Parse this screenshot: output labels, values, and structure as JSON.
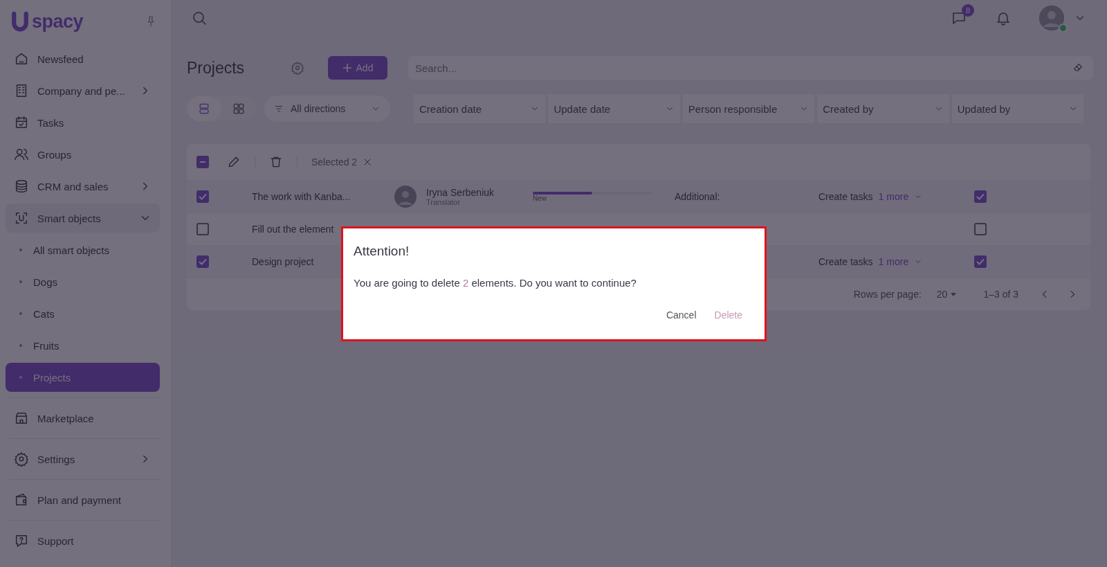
{
  "logo": {
    "text": "spacy"
  },
  "sidebar": {
    "sections": [
      [
        {
          "label": "Newsfeed",
          "expandable": false,
          "selected": false
        },
        {
          "label": "Company and pe...",
          "expandable": true,
          "expanded": false,
          "selected": false
        },
        {
          "label": "Tasks",
          "expandable": false,
          "selected": false
        },
        {
          "label": "Groups",
          "expandable": false,
          "selected": false
        },
        {
          "label": "CRM and sales",
          "expandable": true,
          "expanded": false,
          "selected": false
        },
        {
          "label": "Smart objects",
          "expandable": true,
          "expanded": true,
          "selected": false,
          "children": [
            {
              "label": "All smart objects",
              "selected": false
            },
            {
              "label": "Dogs",
              "selected": false
            },
            {
              "label": "Cats",
              "selected": false
            },
            {
              "label": "Fruits",
              "selected": false
            },
            {
              "label": "Projects",
              "selected": true
            }
          ]
        }
      ],
      [
        {
          "label": "Marketplace",
          "expandable": false,
          "selected": false
        }
      ],
      [
        {
          "label": "Settings",
          "expandable": true,
          "expanded": false,
          "selected": false
        }
      ],
      [
        {
          "label": "Plan and payment",
          "expandable": false,
          "selected": false
        }
      ],
      [
        {
          "label": "Support",
          "expandable": false,
          "selected": false
        }
      ]
    ]
  },
  "topbar": {
    "chat_badge": "8",
    "user_online": true
  },
  "page": {
    "title": "Projects",
    "add_button": "Add",
    "search": {
      "placeholder": "Search..."
    },
    "views": [
      {
        "kind": "list",
        "selected": true
      },
      {
        "kind": "grid",
        "selected": false
      }
    ],
    "direction": "All directions",
    "filters": [
      "Creation date",
      "Update date",
      "Person responsible",
      "Created by",
      "Updated by"
    ]
  },
  "table": {
    "bulk": {
      "indeterminate": true,
      "selected_label": "Selected 2"
    },
    "rows": [
      {
        "selected": true,
        "name": "The work with Kanba...",
        "person": {
          "name": "Iryna Serbeniuk",
          "role": "Translator"
        },
        "progress": {
          "level": 0.5,
          "label": "New"
        },
        "additional": "Additional:",
        "tasks": "Create tasks",
        "more": "1 more",
        "flag": true
      },
      {
        "selected": false,
        "name": "Fill out the element",
        "flag": false
      },
      {
        "selected": true,
        "name": "Design project",
        "tasks": "Create tasks",
        "more": "1 more",
        "flag": true
      }
    ],
    "pagination": {
      "rows_label": "Rows per page:",
      "rows_value": "20",
      "range": "1–3 of 3"
    }
  },
  "dialog": {
    "title": "Attention!",
    "message_start": "You are going to delete ",
    "count": "2",
    "message_end": " elements. Do you want to continue?",
    "buttons": [
      {
        "label": "Cancel",
        "kind": "text"
      },
      {
        "label": "Delete",
        "kind": "danger"
      }
    ]
  }
}
